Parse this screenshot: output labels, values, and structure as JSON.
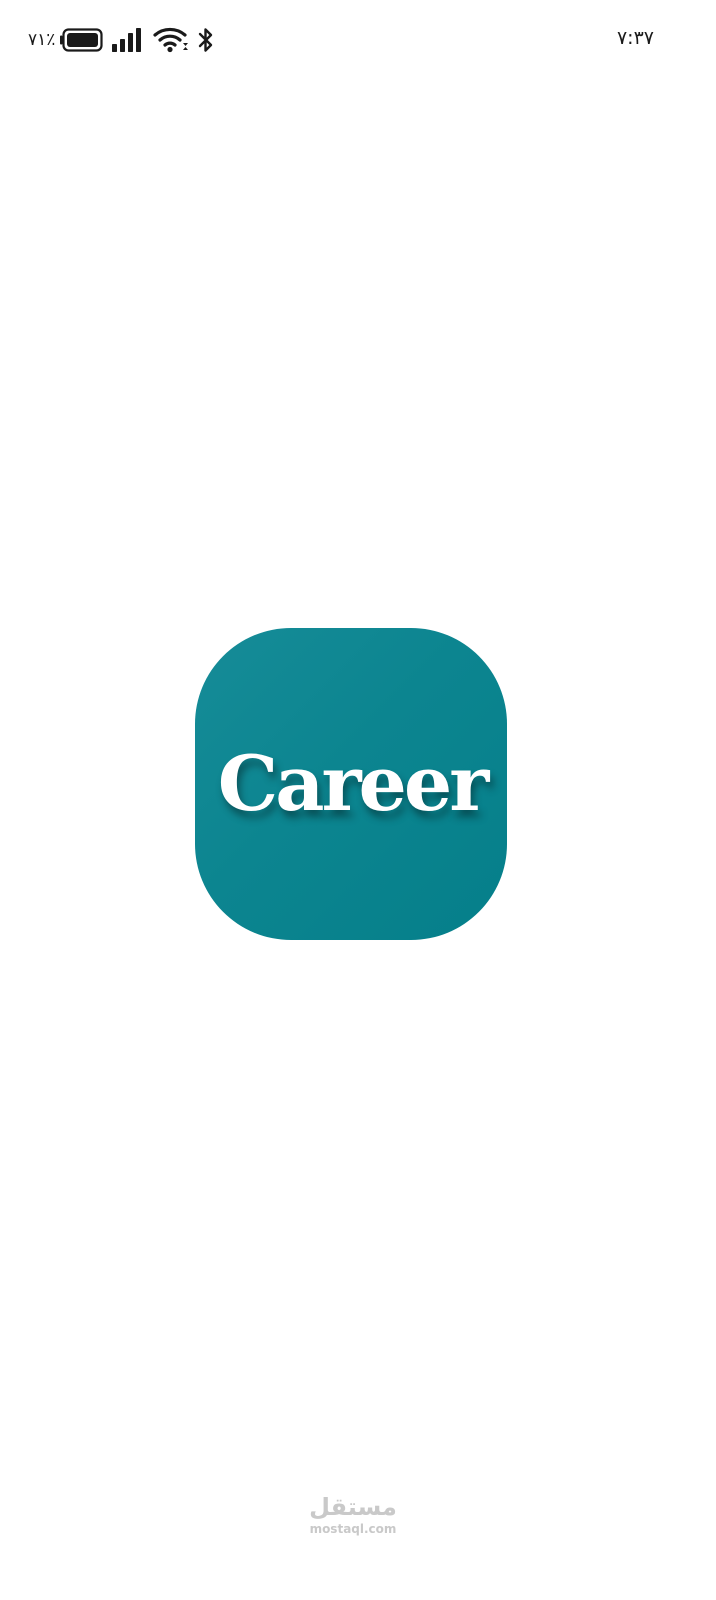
{
  "status_bar": {
    "battery_percent": "٧١٪",
    "battery_level": 0.71,
    "clock": "٧:٣٧",
    "icons": [
      "battery-icon",
      "signal-icon",
      "wifi-icon",
      "bluetooth-icon"
    ]
  },
  "splash": {
    "logo_text": "Career",
    "logo_color": "#0c8590",
    "logo_text_color": "#ffffff"
  },
  "watermark": {
    "arabic": "مستقل",
    "latin": "mostaql.com"
  }
}
